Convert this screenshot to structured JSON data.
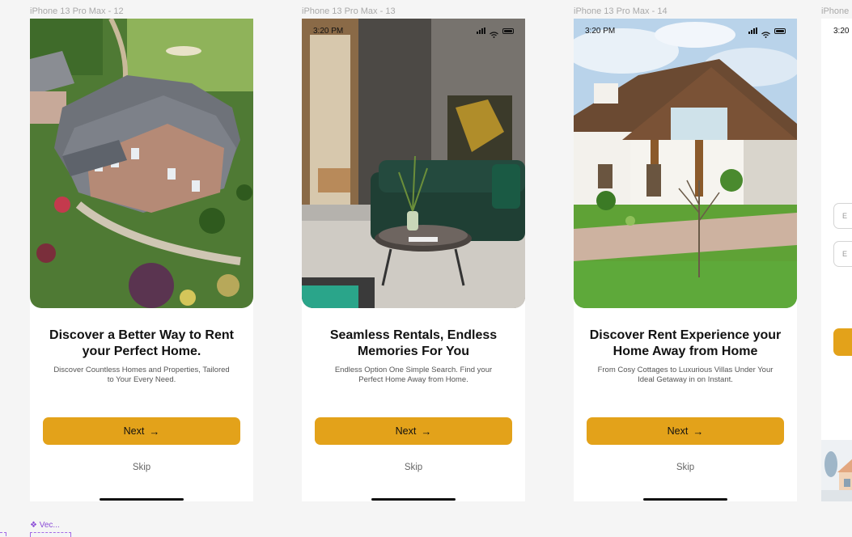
{
  "frames": [
    {
      "label": "iPhone 13 Pro Max - 12",
      "time": "",
      "title": "Discover a Better Way to Rent your Perfect Home.",
      "subtitle": "Discover Countless Homes and Properties, Tailored to Your Every Need.",
      "next_label": "Next",
      "skip_label": "Skip"
    },
    {
      "label": "iPhone 13 Pro Max - 13",
      "time": "3:20 PM",
      "title": "Seamless Rentals, Endless Memories For You",
      "subtitle": "Endless Option One Simple Search. Find your Perfect Home Away from Home.",
      "next_label": "Next",
      "skip_label": "Skip"
    },
    {
      "label": "iPhone 13 Pro Max - 14",
      "time": "3:20 PM",
      "title": "Discover Rent Experience your Home Away from Home",
      "subtitle": "From Cosy Cottages to Luxurious Villas Under Your Ideal Getaway in on Instant.",
      "next_label": "Next",
      "skip_label": "Skip"
    }
  ],
  "partial_frame": {
    "label": "iPhone",
    "time": "3:20",
    "field1_placeholder": "E",
    "field2_placeholder": "E"
  },
  "vector_layer_label": "❖ Vec...",
  "colors": {
    "accent": "#e3a21a",
    "canvas": "#f5f5f5",
    "selection": "#8a4bd6"
  },
  "icons": {
    "next_arrow": "arrow-right-icon",
    "signal": "signal-icon",
    "wifi": "wifi-icon",
    "battery": "battery-icon"
  }
}
